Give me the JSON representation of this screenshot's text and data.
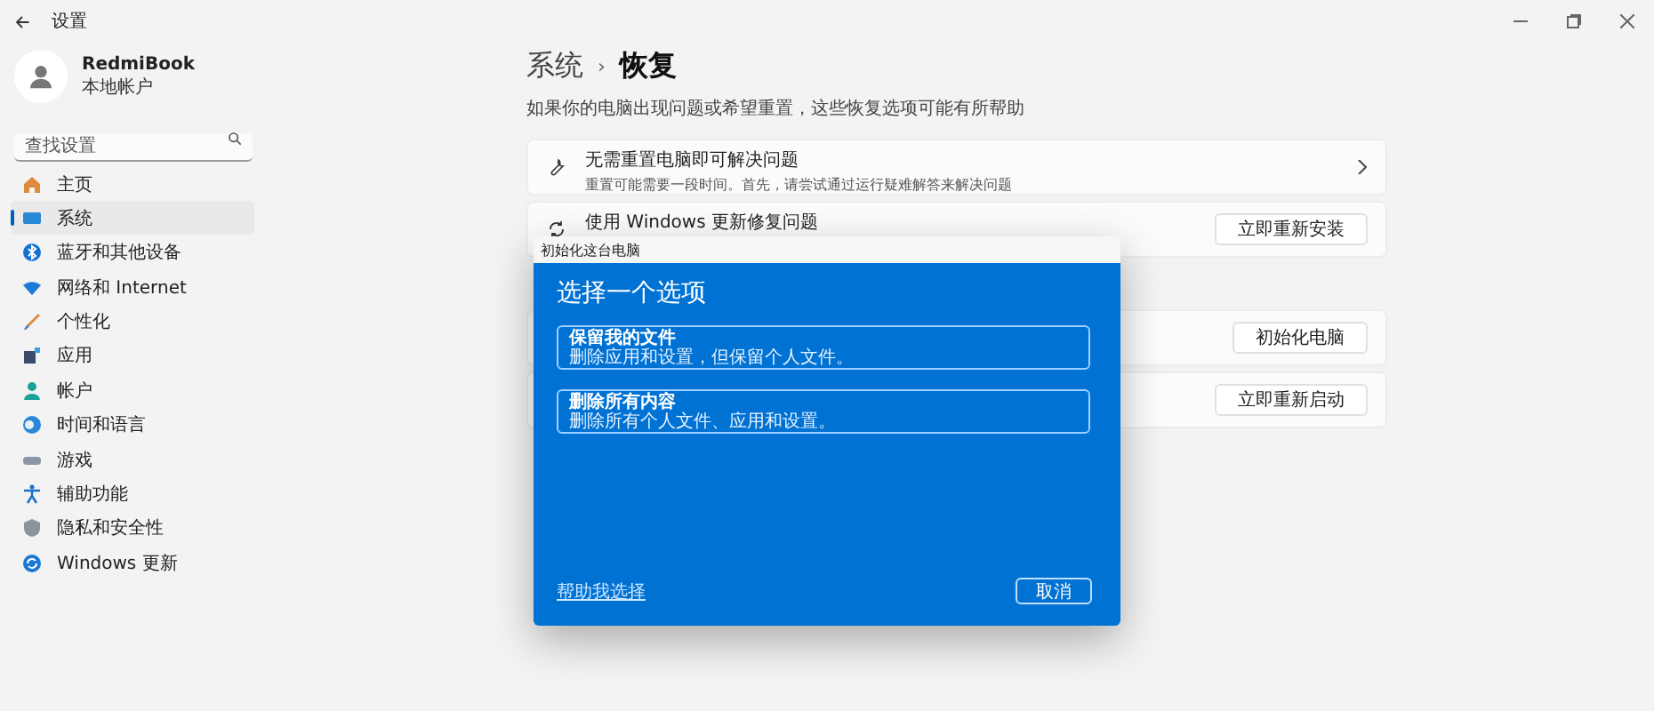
{
  "window": {
    "title": "设置"
  },
  "profile": {
    "name": "RedmiBook",
    "account": "本地帐户"
  },
  "search": {
    "placeholder": "查找设置"
  },
  "sidebar": {
    "items": [
      {
        "label": "主页",
        "selected": false
      },
      {
        "label": "系统",
        "selected": true
      },
      {
        "label": "蓝牙和其他设备",
        "selected": false
      },
      {
        "label": "网络和 Internet",
        "selected": false
      },
      {
        "label": "个性化",
        "selected": false
      },
      {
        "label": "应用",
        "selected": false
      },
      {
        "label": "帐户",
        "selected": false
      },
      {
        "label": "时间和语言",
        "selected": false
      },
      {
        "label": "游戏",
        "selected": false
      },
      {
        "label": "辅助功能",
        "selected": false
      },
      {
        "label": "隐私和安全性",
        "selected": false
      },
      {
        "label": "Windows 更新",
        "selected": false
      }
    ]
  },
  "breadcrumb": {
    "parent": "系统",
    "separator": "›",
    "current": "恢复"
  },
  "description": "如果你的电脑出现问题或希望重置，这些恢复选项可能有所帮助",
  "rows": [
    {
      "kind": "link",
      "title": "无需重置电脑即可解决问题",
      "subtitle": "重置可能需要一段时间。首先，请尝试通过运行疑难解答来解决问题"
    },
    {
      "kind": "button",
      "title": "使用 Windows 更新修复问题",
      "button": "立即重新安装"
    },
    {
      "kind": "button",
      "button": "初始化电脑"
    },
    {
      "kind": "button",
      "button": "立即重新启动"
    }
  ],
  "dialog": {
    "title": "初始化这台电脑",
    "heading": "选择一个选项",
    "options": [
      {
        "title": "保留我的文件",
        "subtitle": "删除应用和设置，但保留个人文件。"
      },
      {
        "title": "删除所有内容",
        "subtitle": "删除所有个人文件、应用和设置。"
      }
    ],
    "help_link": "帮助我选择",
    "cancel": "取消"
  }
}
